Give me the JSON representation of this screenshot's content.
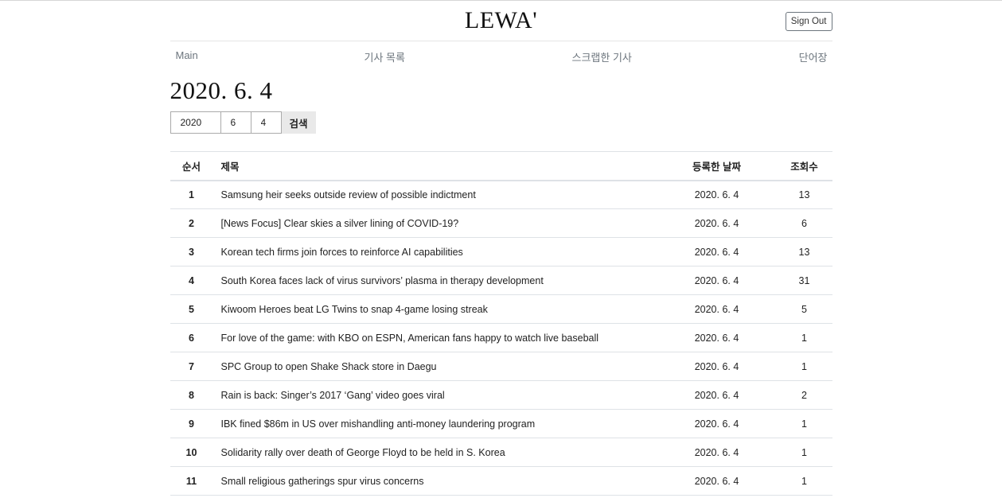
{
  "header": {
    "logo": "LEWA'",
    "sign_out_label": "Sign Out"
  },
  "nav": {
    "items": [
      {
        "label": "Main"
      },
      {
        "label": "기사 목록"
      },
      {
        "label": "스크랩한 기사"
      },
      {
        "label": "단어장"
      }
    ]
  },
  "page": {
    "date_title": "2020. 6. 4"
  },
  "search": {
    "year_value": "2020",
    "month_value": "6",
    "day_value": "4",
    "button_label": "검색"
  },
  "table": {
    "headers": {
      "num": "순서",
      "title": "제목",
      "date": "등록한 날짜",
      "views": "조회수"
    },
    "rows": [
      {
        "num": "1",
        "title": "Samsung heir seeks outside review of possible indictment",
        "date": "2020. 6. 4",
        "views": "13"
      },
      {
        "num": "2",
        "title": "[News Focus] Clear skies a silver lining of COVID-19?",
        "date": "2020. 6. 4",
        "views": "6"
      },
      {
        "num": "3",
        "title": "Korean tech firms join forces to reinforce AI capabilities",
        "date": "2020. 6. 4",
        "views": "13"
      },
      {
        "num": "4",
        "title": "South Korea faces lack of virus survivors’ plasma in therapy development",
        "date": "2020. 6. 4",
        "views": "31"
      },
      {
        "num": "5",
        "title": "Kiwoom Heroes beat LG Twins to snap 4-game losing streak",
        "date": "2020. 6. 4",
        "views": "5"
      },
      {
        "num": "6",
        "title": "For love of the game: with KBO on ESPN, American fans happy to watch live baseball",
        "date": "2020. 6. 4",
        "views": "1"
      },
      {
        "num": "7",
        "title": "SPC Group to open Shake Shack store in Daegu",
        "date": "2020. 6. 4",
        "views": "1"
      },
      {
        "num": "8",
        "title": "Rain is back: Singer’s 2017 ‘Gang’ video goes viral",
        "date": "2020. 6. 4",
        "views": "2"
      },
      {
        "num": "9",
        "title": "IBK fined $86m in US over mishandling anti-money laundering program",
        "date": "2020. 6. 4",
        "views": "1"
      },
      {
        "num": "10",
        "title": "Solidarity rally over death of George Floyd to be held in S. Korea",
        "date": "2020. 6. 4",
        "views": "1"
      },
      {
        "num": "11",
        "title": "Small religious gatherings spur virus concerns",
        "date": "2020. 6. 4",
        "views": "1"
      }
    ]
  }
}
